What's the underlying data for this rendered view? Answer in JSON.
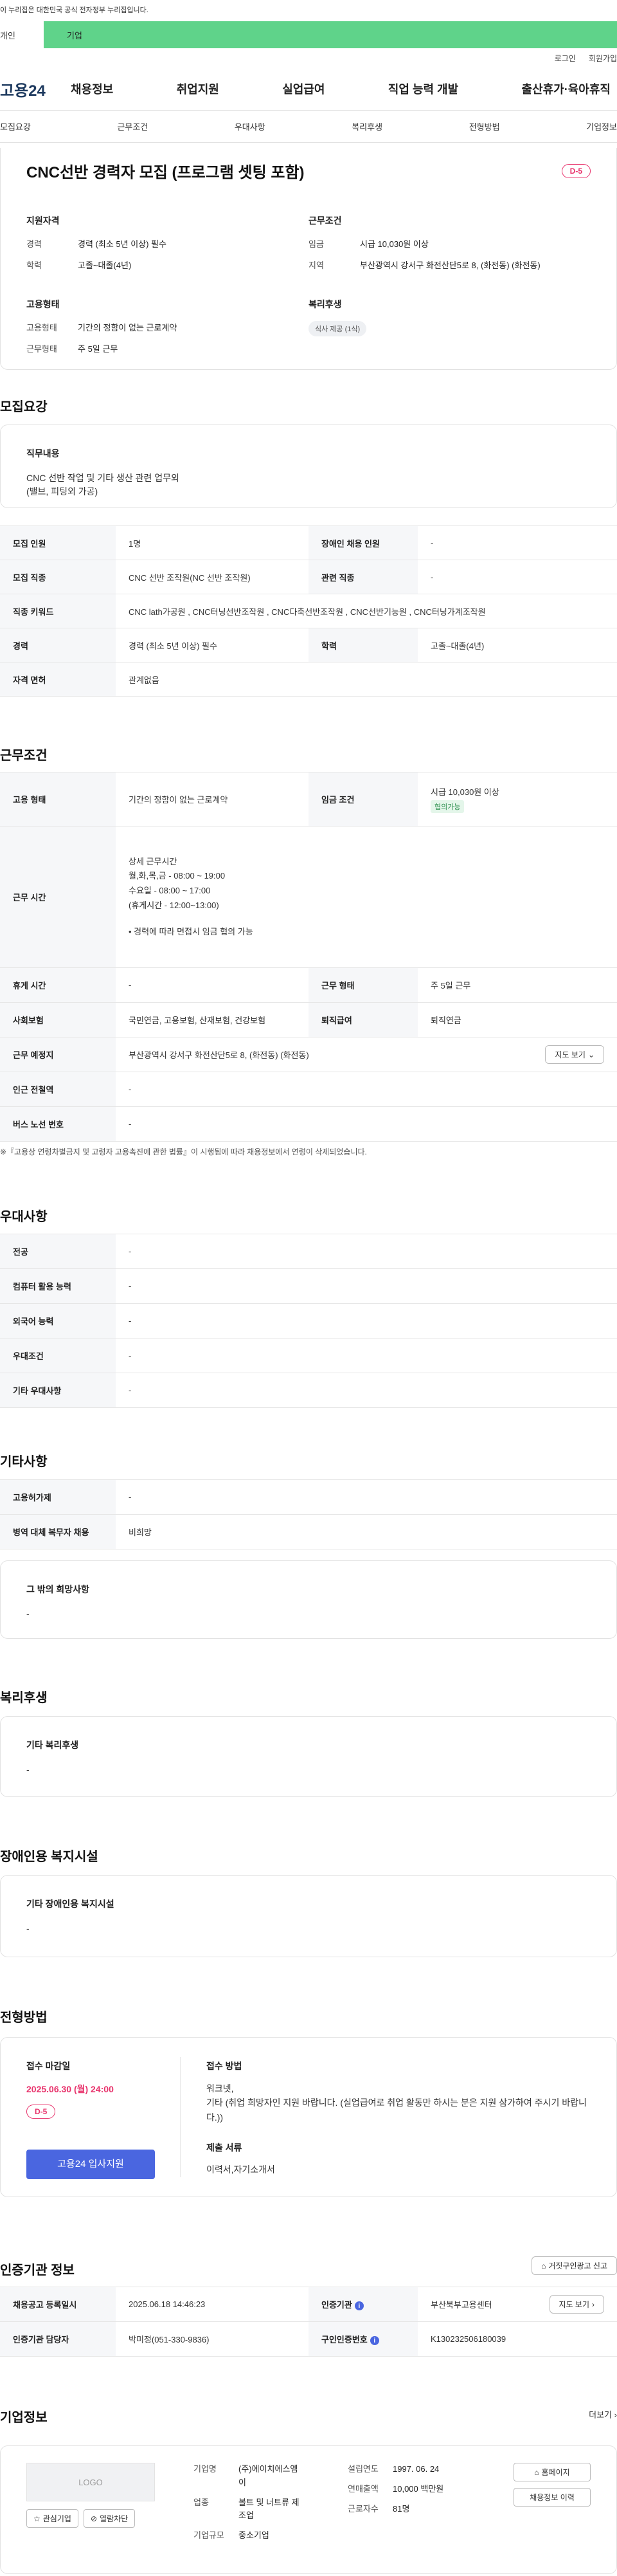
{
  "banner": {
    "text": "이 누리집은 대한민국 공식 전자정부 누리집입니다."
  },
  "user_tabs": {
    "personal": "개인",
    "company": "기업"
  },
  "top_links": {
    "login": "로그인",
    "join": "회원가입"
  },
  "gnb": {
    "logo": "고용24",
    "menu": [
      "채용정보",
      "취업지원",
      "실업급여",
      "직업 능력 개발",
      "출산휴가·육아휴직"
    ]
  },
  "tabs": [
    "모집요강",
    "근무조건",
    "우대사항",
    "복리후생",
    "전형방법",
    "기업정보"
  ],
  "summary": {
    "title": "CNC선반 경력자 모집 (프로그램 셋팅 포함)",
    "dday": "D-5",
    "qualification_title": "지원자격",
    "qualification": [
      {
        "k": "경력",
        "v": "경력 (최소 5년 이상) 필수"
      },
      {
        "k": "학력",
        "v": "고졸~대졸(4년)"
      }
    ],
    "conditions_title": "근무조건",
    "conditions": [
      {
        "k": "임금",
        "v": "시급 10,030원 이상"
      },
      {
        "k": "지역",
        "v": "부산광역시 강서구 화전산단5로 8, (화전동) (화전동)"
      }
    ],
    "employment_title": "고용형태",
    "employment": [
      {
        "k": "고용형태",
        "v": "기간의 정함이 없는 근로계약"
      },
      {
        "k": "근무형태",
        "v": "주 5일 근무"
      }
    ],
    "welfare_title": "복리후생",
    "welfare_chip": "식사 제공 (1식)"
  },
  "recruit": {
    "title": "모집요강",
    "duty_title": "직무내용",
    "duty_text_1": "CNC 선반 작업 및 기타 생산 관련 업무외",
    "duty_text_2": "(밸브, 피팅외 가공)",
    "rows": [
      {
        "h1": "모집 인원",
        "v1": "1명",
        "h2": "장애인 채용 인원",
        "v2": "-"
      },
      {
        "h1": "모집 직종",
        "v1": "CNC 선반 조작원(NC 선반 조작원)",
        "h2": "관련 직종",
        "v2": "-"
      },
      {
        "h1": "직종 키워드",
        "v1": "CNC lath가공원 , CNC터닝선반조작원 , CNC다축선반조작원 , CNC선반기능원 , CNC터닝가계조작원"
      },
      {
        "h1": "경력",
        "v1": "경력 (최소 5년 이상) 필수",
        "h2": "학력",
        "v2": "고졸~대졸(4년)"
      },
      {
        "h1": "자격 면허",
        "v1": "관계없음"
      }
    ]
  },
  "work": {
    "title": "근무조건",
    "employment_h": "고용 형태",
    "employment_v": "기간의 정함이 없는 근로계약",
    "wage_h": "임금 조건",
    "wage_v": "시급 10,030원 이상",
    "wage_badge": "협의가능",
    "hours_h": "근무 시간",
    "hours_title": "상세 근무시간",
    "hours_lines": [
      "월,화,목,금 - 08:00 ~ 19:00",
      "수요일 - 08:00 ~ 17:00",
      "(휴게시간 - 12:00~13:00)"
    ],
    "hours_note": "• 경력에 따라 면접시 임금 협의 가능",
    "rest_h": "휴게 시간",
    "rest_v": "-",
    "type_h": "근무 형태",
    "type_v": "주 5일 근무",
    "insurance_h": "사회보험",
    "insurance_v": "국민연금, 고용보험, 산재보험, 건강보험",
    "retire_h": "퇴직급여",
    "retire_v": "퇴직연금",
    "place_h": "근무 예정지",
    "place_v": "부산광역시 강서구 화전산단5로 8, (화전동) (화전동)",
    "map_btn": "지도 보기",
    "subway_h": "인근 전철역",
    "subway_v": "-",
    "bus_h": "버스 노선 번호",
    "bus_v": "-",
    "note": "※『고용상 연령차별금지 및 고령자 고용촉진에 관한 법률』이 시행됨에 따라 채용정보에서 연령이 삭제되었습니다."
  },
  "prefer": {
    "title": "우대사항",
    "rows": [
      {
        "h": "전공",
        "v": "-"
      },
      {
        "h": "컴퓨터 활용 능력",
        "v": "-"
      },
      {
        "h": "외국어 능력",
        "v": "-"
      },
      {
        "h": "우대조건",
        "v": "-"
      },
      {
        "h": "기타 우대사항",
        "v": "-"
      }
    ]
  },
  "etc": {
    "title": "기타사항",
    "rows": [
      {
        "h": "고용허가제",
        "v": "-"
      },
      {
        "h": "병역 대체 복무자 채용",
        "v": "비희망"
      }
    ],
    "other_title": "그 밖의 희망사항",
    "other_value": "-"
  },
  "welfare": {
    "title": "복리후생",
    "box_title": "기타 복리후생",
    "box_value": "-"
  },
  "disability": {
    "title": "장애인용 복지시설",
    "box_title": "기타 장애인용 복지시설",
    "box_value": "-"
  },
  "selection": {
    "title": "전형방법",
    "deadline_label": "접수 마감일",
    "deadline": "2025.06.30 (월) 24:00",
    "dday": "D-5",
    "apply_btn": "고용24 입사지원",
    "method_label": "접수 방법",
    "method_1": "워크넷,",
    "method_2": "기타 (취업 희망자인 지원 바랍니다. (실업급여로 취업 활동만 하시는 분은 지원 삼가하여 주시기 바랍니다.))",
    "docs_label": "제출 서류",
    "docs_value": "이력서,자기소개서"
  },
  "agency": {
    "title": "인증기관 정보",
    "report_btn": "거짓구인광고 신고",
    "date_h": "채용공고 등록일시",
    "date_v": "2025.06.18 14:46:23",
    "agency_h": "인증기관",
    "agency_v": "부산북부고용센터",
    "map_btn": "지도 보기",
    "manager_h": "인증기관 담당자",
    "manager_v": "박미정(051-330-9836)",
    "id_h": "구인인증번호",
    "id_v": "K130232506180039"
  },
  "company": {
    "title": "기업정보",
    "more": "더보기",
    "logo": "LOGO",
    "fav_btn": "관심기업",
    "block_btn": "열람차단",
    "name_h": "기업명",
    "name_v_1": "(주)에이치에스엠",
    "name_v_2": "이",
    "industry_h": "업종",
    "industry_v_1": "볼트 및 너트류 제",
    "industry_v_2": "조업",
    "size_h": "기업규모",
    "size_v": "중소기업",
    "founded_h": "설립연도",
    "founded_v": "1997. 06. 24",
    "sales_h": "연매출액",
    "sales_v": "10,000 백만원",
    "staff_h": "근로자수",
    "staff_v": "81명",
    "home_btn": "홈페이지",
    "jobs_btn": "채용정보 이력"
  }
}
